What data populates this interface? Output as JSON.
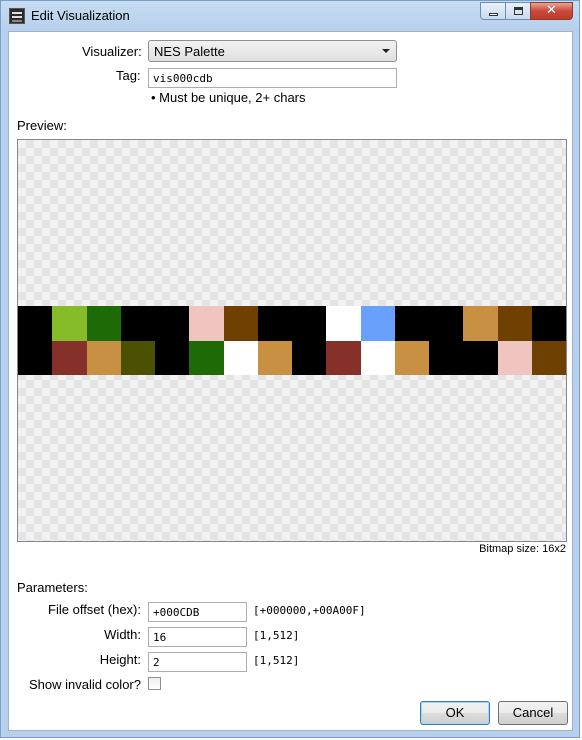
{
  "window": {
    "title": "Edit Visualization",
    "close_glyph": "✕"
  },
  "form": {
    "visualizer_label": "Visualizer:",
    "visualizer_value": "NES Palette",
    "tag_label": "Tag:",
    "tag_value": "vis000cdb",
    "tag_hint": "• Must be unique, 2+ chars"
  },
  "preview": {
    "label": "Preview:",
    "bitmap_size": "Bitmap size: 16x2",
    "pixels": [
      [
        "#000000",
        "#86bb2a",
        "#1d6a06",
        "#000000",
        "#000000",
        "#f0c4bf",
        "#6e4102",
        "#000000",
        "#000000",
        "#ffffff",
        "#69a0fb",
        "#000000",
        "#000000",
        "#c89043",
        "#6e4102",
        "#000000"
      ],
      [
        "#000000",
        "#85312a",
        "#c89043",
        "#4b5002",
        "#000000",
        "#1d6a06",
        "#ffffff",
        "#c89043",
        "#000000",
        "#85312a",
        "#ffffff",
        "#c89043",
        "#000000",
        "#000000",
        "#f0c4bf",
        "#6e4102"
      ]
    ]
  },
  "params": {
    "header": "Parameters:",
    "offset_label": "File offset (hex):",
    "offset_value": "+000CDB",
    "offset_range": "[+000000,+00A00F]",
    "width_label": "Width:",
    "width_value": "16",
    "width_range": "[1,512]",
    "height_label": "Height:",
    "height_value": "2",
    "height_range": "[1,512]",
    "invalid_label": "Show invalid color?"
  },
  "buttons": {
    "ok": "OK",
    "cancel": "Cancel"
  }
}
